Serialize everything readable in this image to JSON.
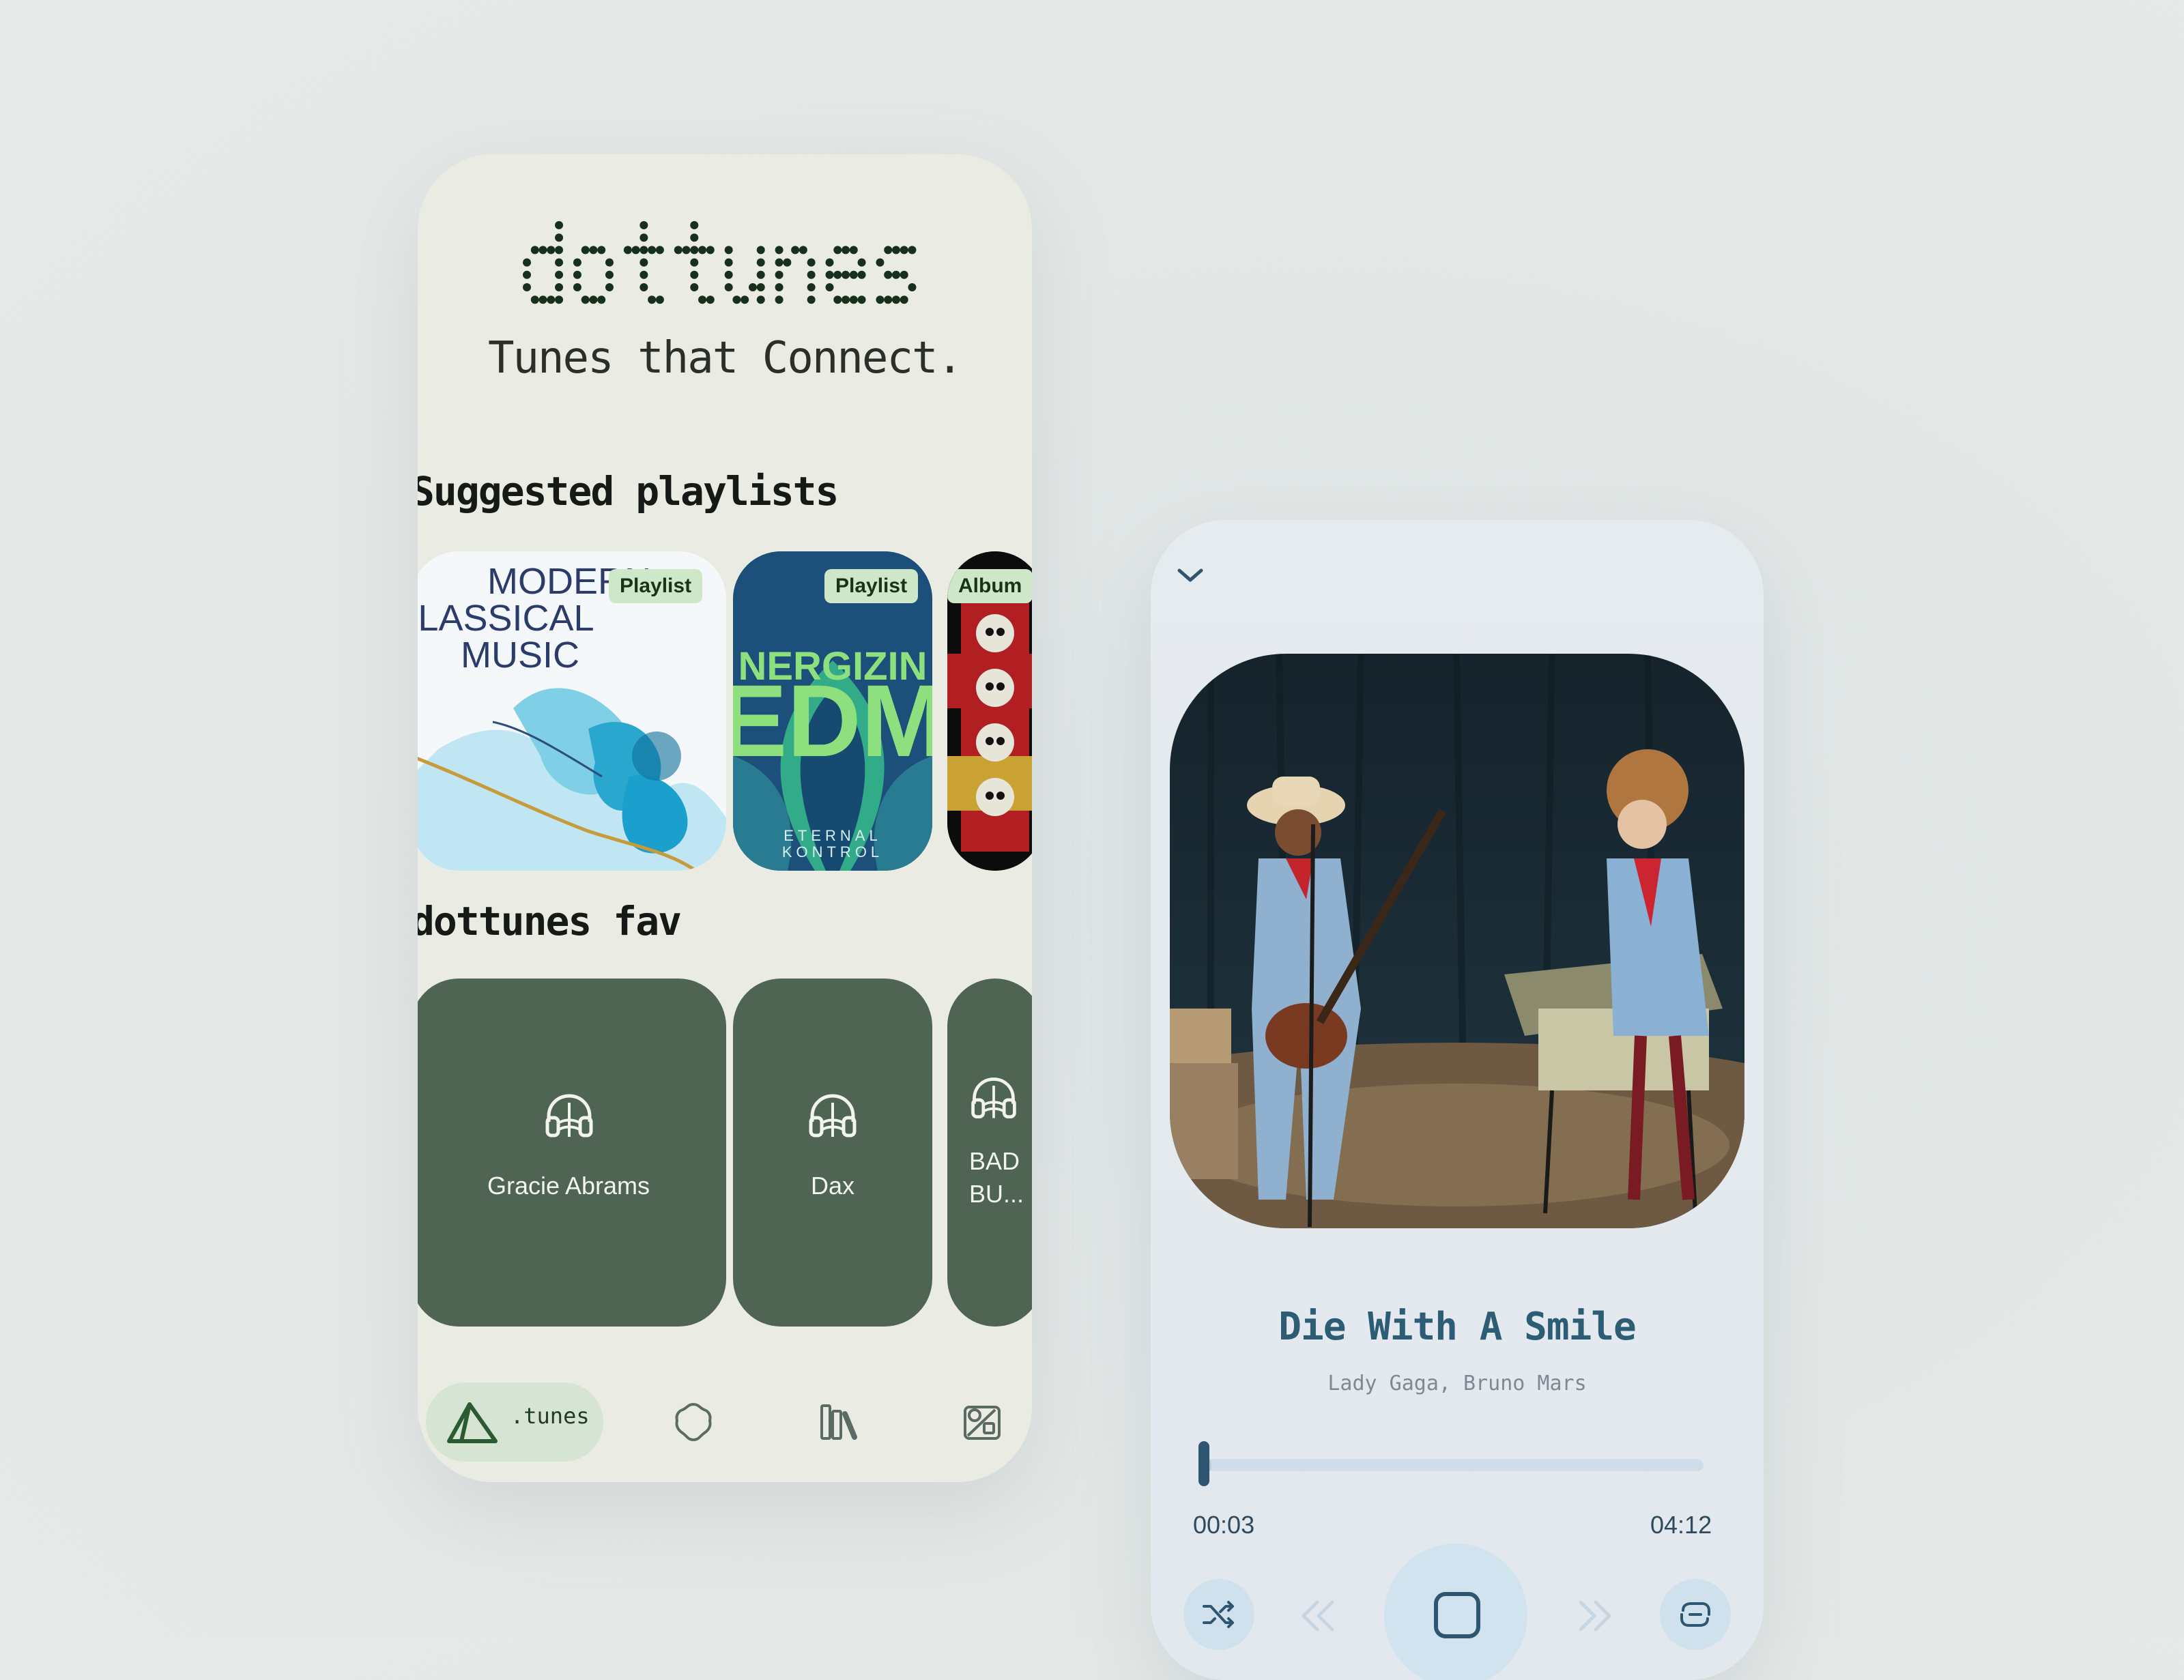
{
  "home": {
    "logo": "dottunes",
    "tagline": "Tunes that Connect.",
    "suggested_title": "Suggested playlists",
    "suggested": [
      {
        "badge": "Playlist",
        "art_text": [
          "MODERN",
          "CLASSICAL",
          "MUSIC"
        ]
      },
      {
        "badge": "Playlist",
        "art_text": [
          "NERGIZIN",
          "EDM",
          "ETERNAL",
          "KONTROL"
        ]
      },
      {
        "badge": "Album"
      }
    ],
    "fav_title": "dottunes fav",
    "favs": [
      {
        "name": "Gracie Abrams"
      },
      {
        "name": "Dax"
      },
      {
        "name_line1": "BAD",
        "name_line2": "BU..."
      }
    ],
    "nav": {
      "home_label": ".tunes",
      "items": [
        "home-icon",
        "explore-icon",
        "library-icon",
        "studio-icon"
      ]
    }
  },
  "player": {
    "title": "Die With A Smile",
    "artist": "Lady Gaga, Bruno Mars",
    "elapsed": "00:03",
    "duration": "04:12",
    "progress": 0.012,
    "icons": [
      "collapse-icon",
      "shuffle-icon",
      "previous-icon",
      "stop-icon",
      "next-icon",
      "repeat-icon"
    ]
  }
}
